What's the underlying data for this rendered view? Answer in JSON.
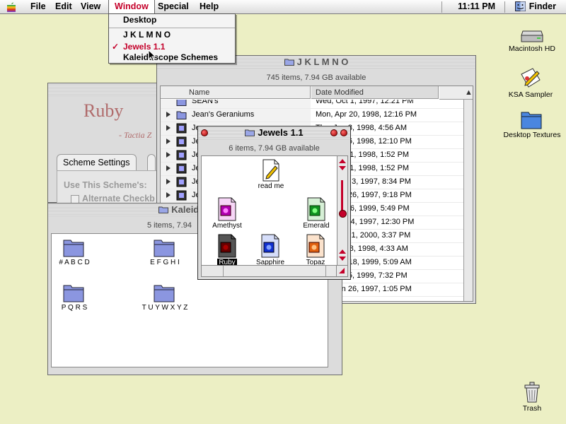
{
  "menubar": {
    "items": [
      "File",
      "Edit",
      "View",
      "Window",
      "Special",
      "Help"
    ],
    "clock": "11:11 PM",
    "app": "Finder"
  },
  "window_menu": {
    "items": [
      {
        "label": "Desktop"
      },
      {
        "label": "J K L M N O"
      },
      {
        "label": "Jewels 1.1",
        "checked": true
      },
      {
        "label": "Kaleidoscope Schemes"
      }
    ],
    "check_mark": "✓"
  },
  "ruby_window": {
    "title_big": "Ruby",
    "subtitle": "- Tactia Z",
    "tab_label": "Scheme Settings",
    "use_label": "Use This Scheme's:",
    "alt_label": "Alternate Checkb"
  },
  "jklmno": {
    "title": "J K L M N O",
    "info": "745 items, 7.94 GB available",
    "col_name": "Name",
    "col_date": "Date Modified",
    "rows": [
      {
        "name": "SEAN's",
        "date": "Wed, Oct 1, 1997, 12:21 PM"
      },
      {
        "name": "Jean's Geraniums",
        "date": "Mon, Apr 20, 1998, 12:16 PM"
      },
      {
        "name": "Je",
        "date": "Thu, Jan 8, 1998, 4:56 AM"
      },
      {
        "name": "Je",
        "date": "Fri, Jun 26, 1998, 12:10 PM"
      },
      {
        "name": "Je",
        "date": "Mon, Jun 1, 1998, 1:52 PM"
      },
      {
        "name": "Je",
        "date": "Mon, Jun 1, 1998, 1:52 PM"
      },
      {
        "name": "Je",
        "date": "Wed, Sep 3, 1997, 8:34 PM"
      },
      {
        "name": "Je",
        "date": "Thu, Jun 26, 1997, 9:18 PM"
      },
      {
        "name": "",
        "date": "Thu, May 6, 1999, 5:49 PM"
      },
      {
        "name": "",
        "date": "Mon, Aug 4, 1997, 12:30 PM"
      },
      {
        "name": "",
        "date": "Wed, Mar 1, 2000, 3:37 PM"
      },
      {
        "name": "",
        "date": "Sun, Mar 8, 1998, 4:33 AM"
      },
      {
        "name": "",
        "date": "Sun, Jan 18, 1999, 5:09 AM"
      },
      {
        "name": "",
        "date": "Sat, Jul 25, 1999, 7:32 PM"
      },
      {
        "name": "",
        "date": "Thu, Jun 26, 1997, 1:05 PM"
      }
    ]
  },
  "kaleido": {
    "title": "Kaleidoscope",
    "info": "5 items, 7.94",
    "folders": [
      "# A B C D",
      "E F G H I",
      "P Q R S",
      "T U Y W X Y Z"
    ]
  },
  "jewels": {
    "title": "Jewels 1.1",
    "info": "6 items, 7.94 GB available",
    "items": [
      {
        "label": "read me",
        "color": "#f0c000"
      },
      {
        "label": "Amethyst",
        "color": "#b000b0"
      },
      {
        "label": "Emerald",
        "color": "#109020"
      },
      {
        "label": "Ruby",
        "color": "#b00000"
      },
      {
        "label": "Sapphire",
        "color": "#1030d0"
      },
      {
        "label": "Topaz",
        "color": "#e06010"
      }
    ]
  },
  "desktop": {
    "icons": [
      "Macintosh HD",
      "KSA Sampler",
      "Desktop Textures",
      "Trash"
    ]
  }
}
